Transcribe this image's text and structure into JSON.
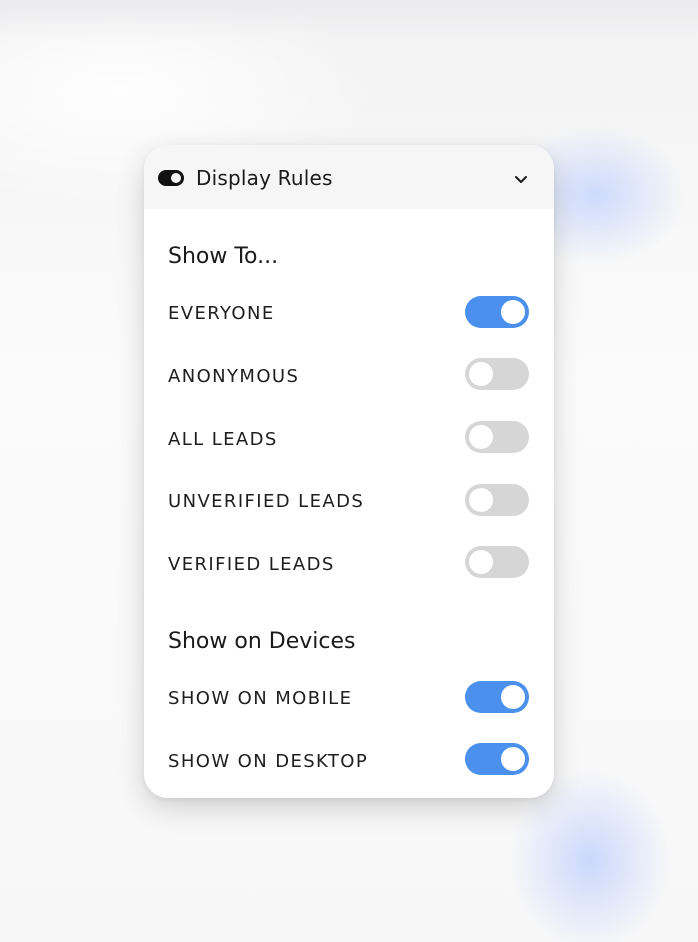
{
  "panel": {
    "title": "Display Rules"
  },
  "show_to": {
    "heading": "Show To...",
    "items": [
      {
        "label": "EVERYONE",
        "on": true
      },
      {
        "label": "ANONYMOUS",
        "on": false
      },
      {
        "label": "ALL LEADS",
        "on": false
      },
      {
        "label": "UNVERIFIED LEADS",
        "on": false
      },
      {
        "label": "VERIFIED LEADS",
        "on": false
      }
    ]
  },
  "devices": {
    "heading": "Show on Devices",
    "items": [
      {
        "label": "SHOW ON MOBILE",
        "on": true
      },
      {
        "label": "SHOW ON DESKTOP",
        "on": true
      }
    ]
  },
  "colors": {
    "toggle_on": "#4a90ec",
    "toggle_off": "#d6d6d6"
  },
  "icons": {
    "header": "toggle-icon",
    "expand": "chevron-down-icon"
  }
}
